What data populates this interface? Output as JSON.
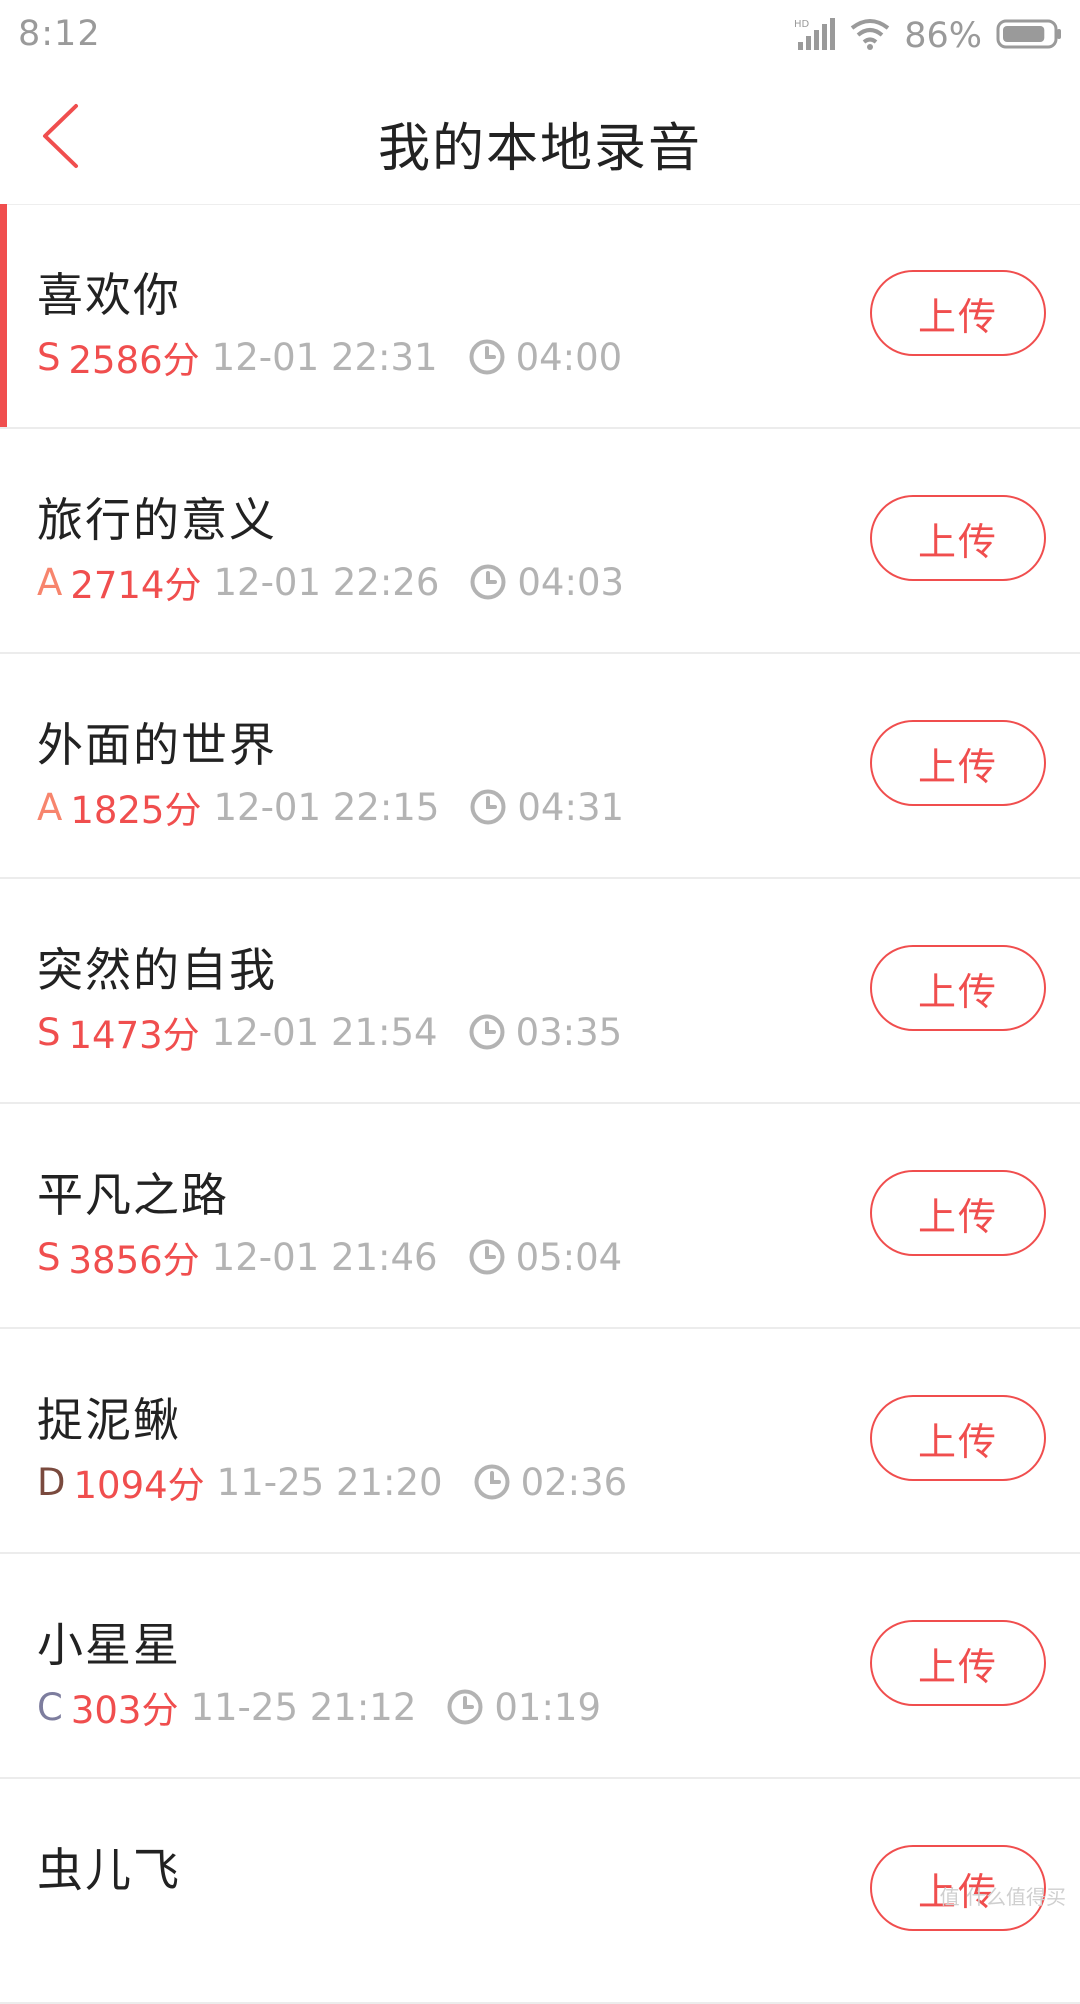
{
  "status_bar": {
    "time": "8:12",
    "battery_text": "86%",
    "battery_level": 0.86,
    "hd_label": "HD"
  },
  "header": {
    "title": "我的本地录音",
    "back_icon": "chevron-left-icon"
  },
  "colors": {
    "accent": "#f04e4e",
    "meta_gray": "#b3b3b3",
    "grade_S": "#f04e4e",
    "grade_A": "#f7856d",
    "grade_D": "#7a4a3e",
    "grade_C": "#7d7d9e"
  },
  "recordings": [
    {
      "title": "喜欢你",
      "grade": "S",
      "score": "2586分",
      "date": "12-01 22:31",
      "duration": "04:00",
      "upload_label": "上传",
      "active": true
    },
    {
      "title": "旅行的意义",
      "grade": "A",
      "score": "2714分",
      "date": "12-01 22:26",
      "duration": "04:03",
      "upload_label": "上传"
    },
    {
      "title": "外面的世界",
      "grade": "A",
      "score": "1825分",
      "date": "12-01 22:15",
      "duration": "04:31",
      "upload_label": "上传"
    },
    {
      "title": "突然的自我",
      "grade": "S",
      "score": "1473分",
      "date": "12-01 21:54",
      "duration": "03:35",
      "upload_label": "上传"
    },
    {
      "title": "平凡之路",
      "grade": "S",
      "score": "3856分",
      "date": "12-01 21:46",
      "duration": "05:04",
      "upload_label": "上传"
    },
    {
      "title": "捉泥鳅",
      "grade": "D",
      "score": "1094分",
      "date": "11-25 21:20",
      "duration": "02:36",
      "upload_label": "上传"
    },
    {
      "title": "小星星",
      "grade": "C",
      "score": "303分",
      "date": "11-25 21:12",
      "duration": "01:19",
      "upload_label": "上传"
    },
    {
      "title": "虫儿飞",
      "grade": "",
      "score": "",
      "date": "",
      "duration": "",
      "upload_label": "上传"
    }
  ],
  "watermark": "值 什么值得买"
}
